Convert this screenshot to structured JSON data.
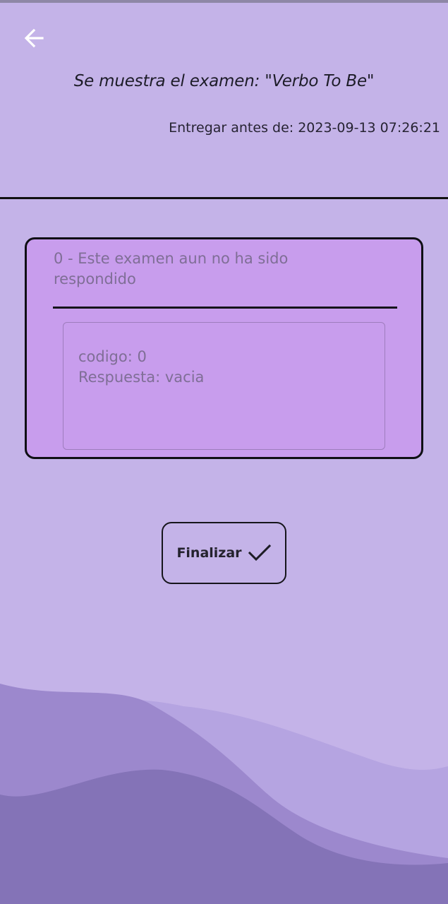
{
  "header": {
    "back_icon": "arrow-left-icon",
    "title": "Se muestra el examen: \"Verbo To Be\"",
    "deadline": "Entregar antes de: 2023-09-13 07:26:21"
  },
  "answer_card": {
    "title": "0 - Este examen aun no ha sido respondido",
    "code_line": "codigo: 0",
    "answer_line": "Respuesta: vacia"
  },
  "finish_button": {
    "label": "Finalizar",
    "icon": "check-icon"
  },
  "colors": {
    "background": "#c4b3e8",
    "card_fill": "#c89ded",
    "wave_light": "#b7a5e2",
    "wave_mid": "#9d89ce",
    "wave_dark": "#8474b7"
  }
}
